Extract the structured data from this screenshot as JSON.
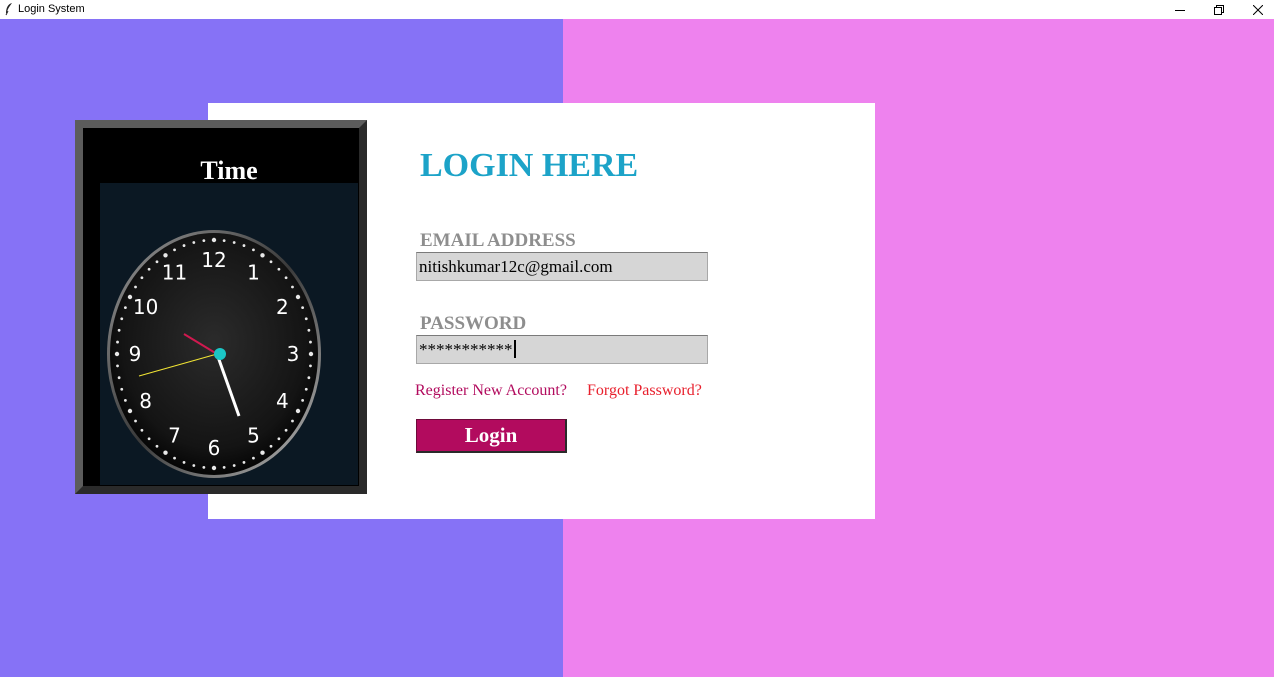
{
  "window": {
    "title": "Login System",
    "minimize_icon": "minimize-icon",
    "restore_icon": "restore-icon",
    "close_icon": "close-icon"
  },
  "colors": {
    "left_background": "#8672f6",
    "right_background": "#ee82ee",
    "heading": "#1ca3c8",
    "register_link": "#b20b5e",
    "forgot_link": "#e8202d",
    "login_button": "#b20b5e"
  },
  "clock_panel": {
    "title": "Time",
    "numerals": [
      "12",
      "1",
      "2",
      "3",
      "4",
      "5",
      "6",
      "7",
      "8",
      "9",
      "10",
      "11"
    ]
  },
  "login_form": {
    "heading": "LOGIN HERE",
    "email_label": "EMAIL ADDRESS",
    "email_value": "nitishkumar12c@gmail.com",
    "password_label": "PASSWORD",
    "password_value": "***********",
    "register_link": "Register New Account?",
    "forgot_link": "Forgot Password?",
    "login_button": "Login"
  }
}
